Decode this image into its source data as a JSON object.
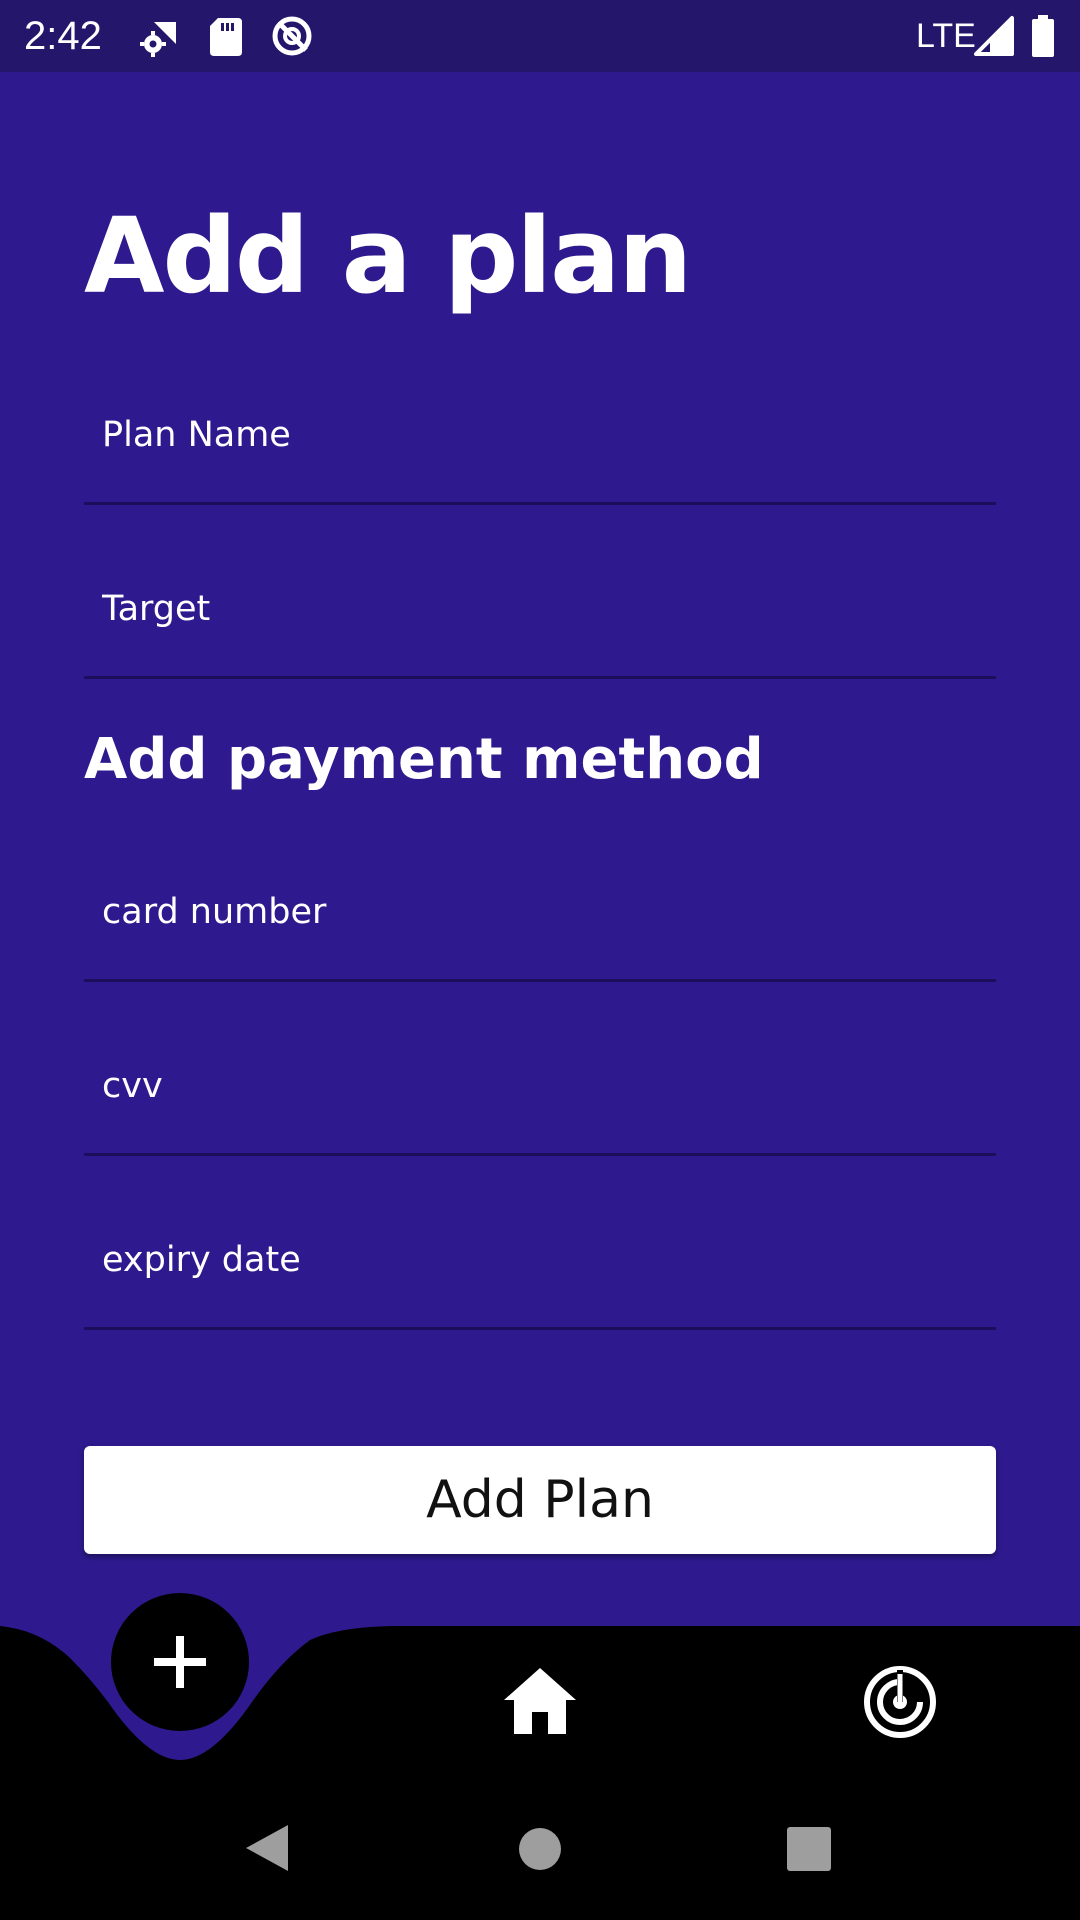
{
  "status_bar": {
    "time": "2:42",
    "network": "LTE",
    "icons": [
      "settings-wifi-icon",
      "sd-card-icon",
      "data-saver-icon",
      "signal-icon",
      "battery-icon"
    ]
  },
  "page": {
    "title": "Add a plan",
    "background_color": "#2e1a8e"
  },
  "plan_form": {
    "plan_name_placeholder": "Plan Name",
    "plan_name_value": "",
    "target_placeholder": "Target",
    "target_value": ""
  },
  "payment": {
    "heading": "Add payment method",
    "card_number_placeholder": "card number",
    "card_number_value": "",
    "cvv_placeholder": "cvv",
    "cvv_value": "",
    "expiry_placeholder": "expiry date",
    "expiry_value": ""
  },
  "actions": {
    "add_plan_label": "Add Plan"
  },
  "bottom_nav": {
    "items": [
      "add-icon",
      "home-icon",
      "radar-icon"
    ]
  },
  "system_nav": {
    "items": [
      "back-icon",
      "home-circle-icon",
      "recents-icon"
    ]
  }
}
